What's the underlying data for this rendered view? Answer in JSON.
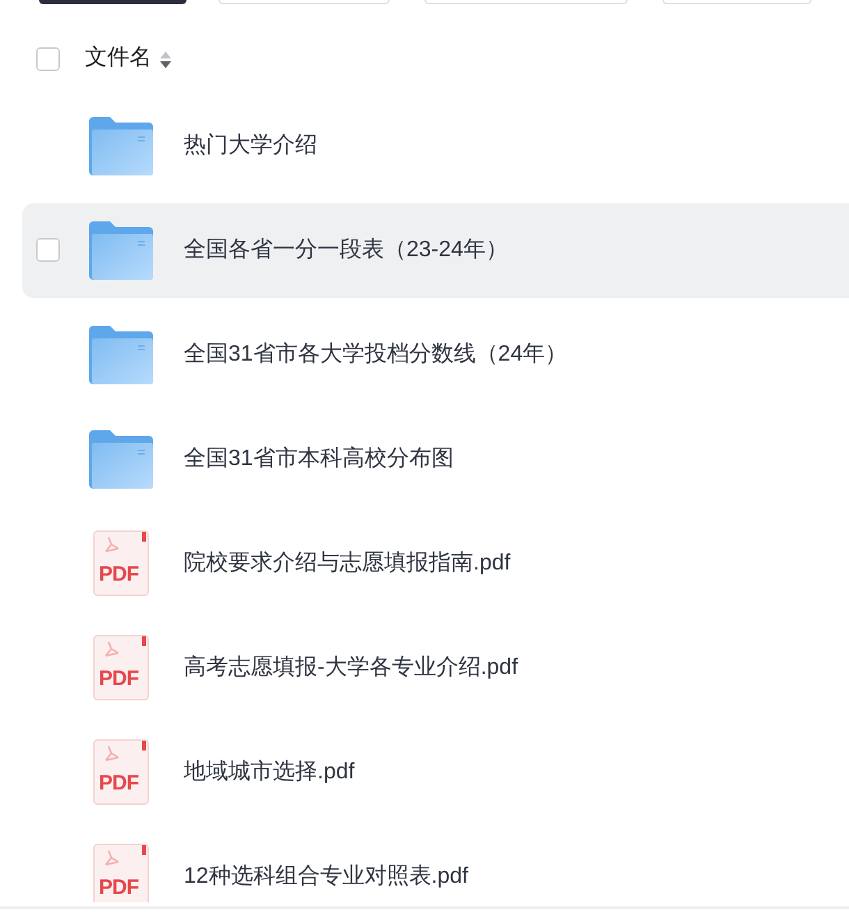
{
  "toolbar": {
    "buttons": [
      {
        "kind": "primary"
      },
      {
        "kind": "outline"
      },
      {
        "kind": "outline"
      },
      {
        "kind": "outline"
      }
    ]
  },
  "table": {
    "header": {
      "checked": false,
      "label": "文件名",
      "sorted_descending": true
    },
    "rows": [
      {
        "kind": "folder",
        "name": "热门大学介绍",
        "hovered": false,
        "checked": false
      },
      {
        "kind": "folder",
        "name": "全国各省一分一段表（23-24年）",
        "hovered": true,
        "checked": false
      },
      {
        "kind": "folder",
        "name": "全国31省市各大学投档分数线（24年）",
        "hovered": false,
        "checked": false
      },
      {
        "kind": "folder",
        "name": "全国31省市本科高校分布图",
        "hovered": false,
        "checked": false
      },
      {
        "kind": "pdf",
        "icon_label": "PDF",
        "name": "院校要求介绍与志愿填报指南.pdf",
        "hovered": false,
        "checked": false
      },
      {
        "kind": "pdf",
        "icon_label": "PDF",
        "name": "高考志愿填报-大学各专业介绍.pdf",
        "hovered": false,
        "checked": false
      },
      {
        "kind": "pdf",
        "icon_label": "PDF",
        "name": "地域城市选择.pdf",
        "hovered": false,
        "checked": false
      },
      {
        "kind": "pdf",
        "icon_label": "PDF",
        "name": "12种选科组合专业对照表.pdf",
        "hovered": false,
        "checked": false
      }
    ]
  }
}
